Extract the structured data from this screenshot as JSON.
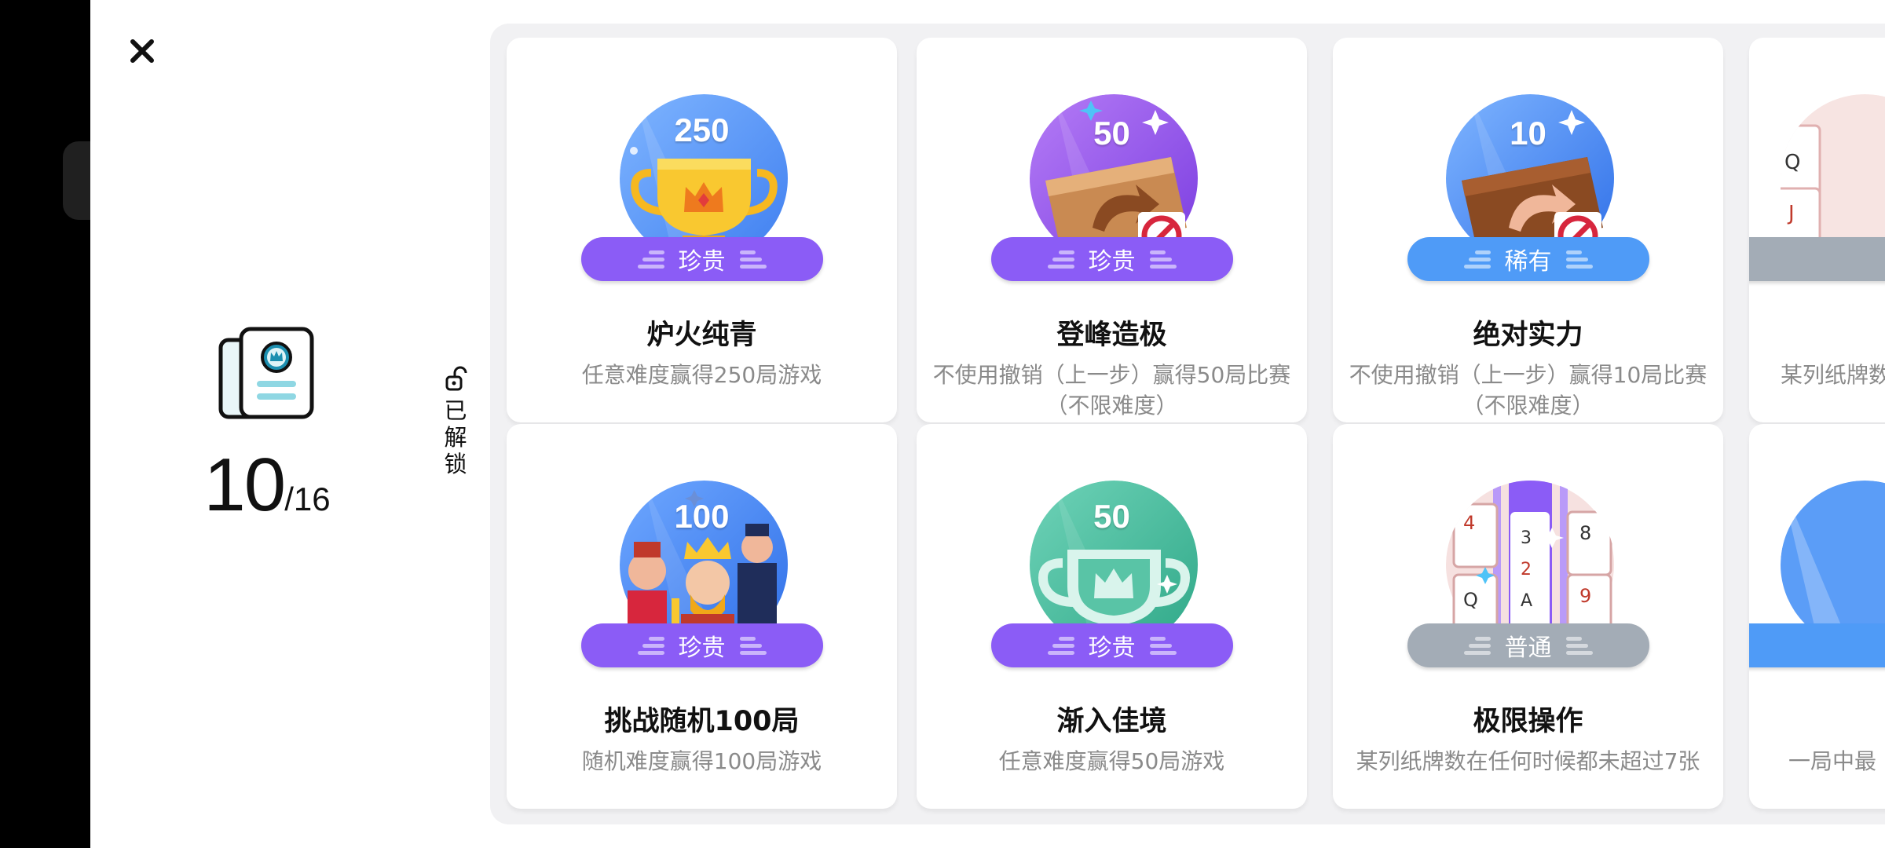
{
  "progress": {
    "unlocked": "10",
    "total": "/16"
  },
  "unlock_label": "已解锁",
  "rarity_colors": {
    "珍贵": "#8b5cf6",
    "稀有": "#4f9bf7",
    "普通": "#a3acb6"
  },
  "cards": [
    {
      "number": "250",
      "rarity": "珍贵",
      "title": "炉火纯青",
      "desc": "任意难度赢得250局游戏",
      "art": "trophy-gold-icon"
    },
    {
      "number": "50",
      "rarity": "珍贵",
      "title": "登峰造极",
      "desc": "不使用撤销（上一步）赢得50局比赛（不限难度）",
      "art": "no-undo-wood-icon"
    },
    {
      "number": "10",
      "rarity": "稀有",
      "title": "绝对实力",
      "desc": "不使用撤销（上一步）赢得10局比赛（不限难度）",
      "art": "no-undo-wood-icon"
    },
    {
      "number": "",
      "rarity": "",
      "title": "",
      "desc": "某列纸牌数",
      "art": "cards-icon"
    },
    {
      "number": "100",
      "rarity": "珍贵",
      "title": "挑战随机100局",
      "desc": "随机难度赢得100局游戏",
      "art": "king-queen-icon"
    },
    {
      "number": "50",
      "rarity": "珍贵",
      "title": "渐入佳境",
      "desc": "任意难度赢得50局游戏",
      "art": "trophy-outline-icon"
    },
    {
      "number": "",
      "rarity": "普通",
      "title": "极限操作",
      "desc": "某列纸牌数在任何时候都未超过7张",
      "art": "playing-cards-icon"
    },
    {
      "number": "",
      "rarity": "",
      "title": "",
      "desc": "一局中最",
      "art": "blue-badge-icon"
    }
  ]
}
